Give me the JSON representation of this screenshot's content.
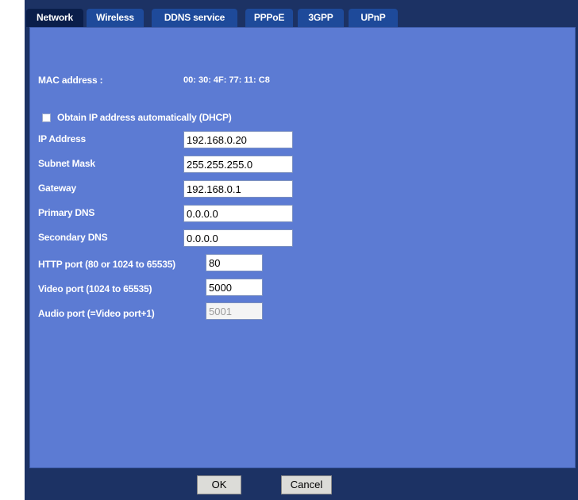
{
  "tabs": [
    {
      "label": "Network",
      "active": true
    },
    {
      "label": "Wireless",
      "active": false
    },
    {
      "label": "DDNS service",
      "active": false
    },
    {
      "label": "PPPoE",
      "active": false
    },
    {
      "label": "3GPP",
      "active": false
    },
    {
      "label": "UPnP",
      "active": false
    }
  ],
  "mac": {
    "label": "MAC address :",
    "value": "00: 30: 4F: 77: 11: C8"
  },
  "dhcp": {
    "label": "Obtain IP address automatically (DHCP)",
    "checked": false
  },
  "fields": {
    "ip": {
      "label": "IP Address",
      "value": "192.168.0.20"
    },
    "subnet": {
      "label": "Subnet Mask",
      "value": "255.255.255.0"
    },
    "gateway": {
      "label": "Gateway",
      "value": "192.168.0.1"
    },
    "primary_dns": {
      "label": "Primary DNS",
      "value": "0.0.0.0"
    },
    "secondary_dns": {
      "label": "Secondary DNS",
      "value": "0.0.0.0"
    },
    "http_port": {
      "label": "HTTP port (80 or 1024 to 65535)",
      "value": "80"
    },
    "video_port": {
      "label": "Video port (1024 to 65535)",
      "value": "5000"
    },
    "audio_port": {
      "label": "Audio port (=Video port+1)",
      "value": "5001",
      "disabled": true
    }
  },
  "buttons": {
    "ok": "OK",
    "cancel": "Cancel"
  },
  "colors": {
    "panel": "#5c7bd3",
    "frame": "#1c3264",
    "tab": "#1e4a9a",
    "tab_active": "#0a1e4a"
  }
}
